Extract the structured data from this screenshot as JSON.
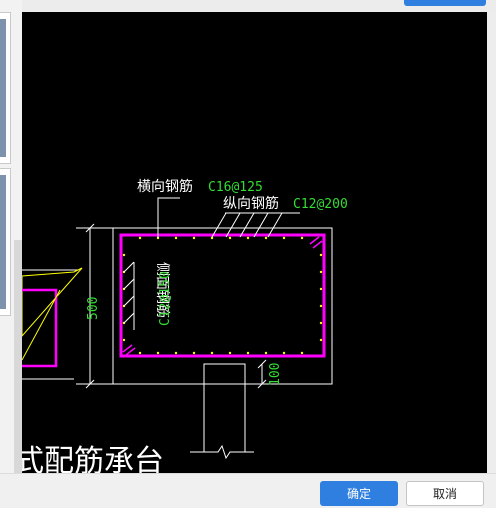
{
  "drawing": {
    "transverse_label": "横向钢筋",
    "transverse_spec": "C16@125",
    "longitudinal_label": "纵向钢筋",
    "longitudinal_spec": "C12@200",
    "side_label": "侧面钢筋",
    "side_spec": "C12@150",
    "height_dim": "500",
    "base_dim": "100",
    "caption": "式配筋承台"
  },
  "colors": {
    "background": "#000000",
    "outline": "#ffffff",
    "rebar": "#ff00ff",
    "spec_text": "#33dd33",
    "marker": "#ffff00",
    "primary_button": "#2f7fe0"
  },
  "footer": {
    "ok_label": "确定",
    "cancel_label": "取消"
  }
}
